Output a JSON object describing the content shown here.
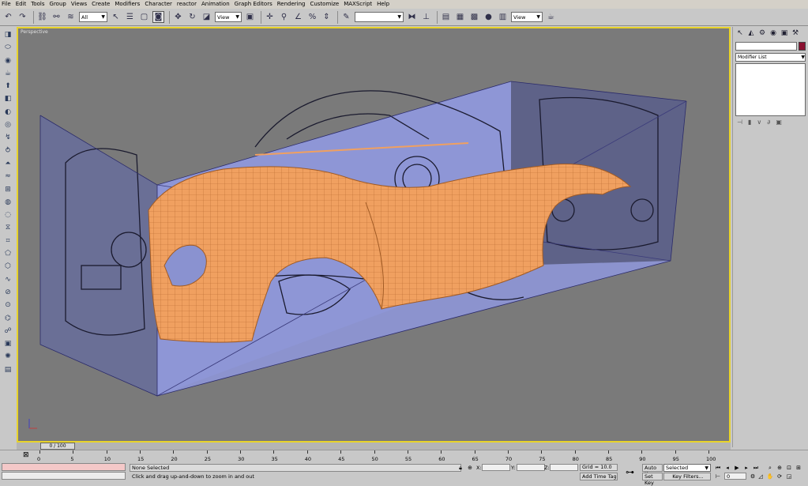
{
  "menu": [
    "File",
    "Edit",
    "Tools",
    "Group",
    "Views",
    "Create",
    "Modifiers",
    "Character",
    "reactor",
    "Animation",
    "Graph Editors",
    "Rendering",
    "Customize",
    "MAXScript",
    "Help"
  ],
  "toolbar": {
    "selection_filter": "All",
    "ref_coord": "View",
    "named_sel": "",
    "render_type": "View"
  },
  "viewport": {
    "label": "Perspective"
  },
  "command_panel": {
    "modifier_list": "Modifier List"
  },
  "timeslider": {
    "frame": "0 / 100"
  },
  "track_ticks": [
    "0",
    "5",
    "10",
    "15",
    "20",
    "25",
    "30",
    "35",
    "40",
    "45",
    "50",
    "55",
    "60",
    "65",
    "70",
    "75",
    "80",
    "85",
    "90",
    "95",
    "100"
  ],
  "status": {
    "selection": "None Selected",
    "prompt": "Click and drag up-and-down to zoom in and out",
    "x_label": "X:",
    "y_label": "Y:",
    "z_label": "Z:",
    "grid": "Grid = 10.0",
    "add_time_tag": "Add Time Tag",
    "auto_key": "Auto Key",
    "set_key": "Set Key",
    "key_mode": "Selected",
    "key_filters": "Key Filters...",
    "frame_value": "0"
  },
  "colors": {
    "viewport_border": "#e8d32a",
    "object_color": "#8a1030",
    "body_mesh": "#f0a060",
    "blueprint_planes": "#8a92d0"
  }
}
